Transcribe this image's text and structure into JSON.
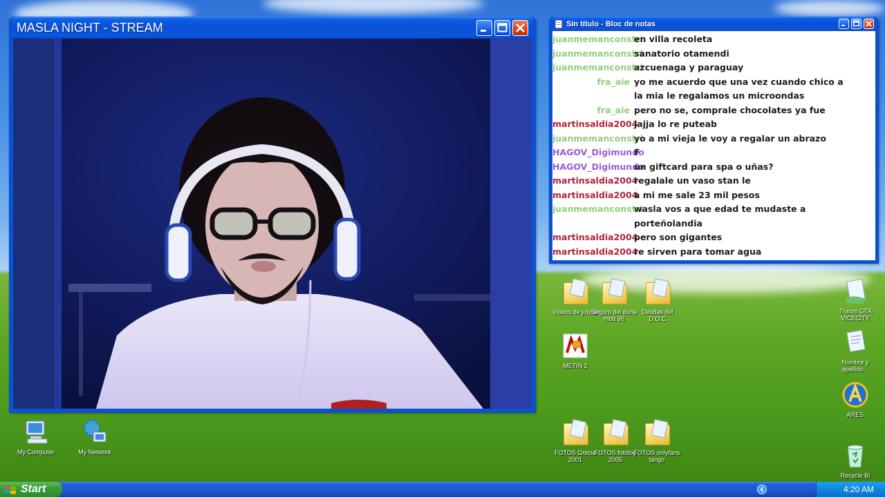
{
  "stream_window": {
    "title": "MASLA NIGHT - STREAM"
  },
  "notepad": {
    "title": "Sin título - Bloc de notas",
    "messages": [
      {
        "user": "juanmemanconstri",
        "text": "en villa recoleta",
        "color": "#8fd07a"
      },
      {
        "user": "juanmemanconstri",
        "text": "sanatorio otamendi",
        "color": "#8fd07a"
      },
      {
        "user": "juanmemanconstri",
        "text": "azcuenaga y paraguay",
        "color": "#8fd07a"
      },
      {
        "user": "fra_aie",
        "text": "yo me acuerdo que una vez cuando chico a la mia le regalamos un microondas",
        "color": "#8fd07a"
      },
      {
        "user": "fra_aie",
        "text": "pero no se, comprale chocolates ya fue",
        "color": "#8fd07a"
      },
      {
        "user": "martinsaldia2004",
        "text": "jajja lo re puteab",
        "color": "#b1223c"
      },
      {
        "user": "juanmemanconstri",
        "text": "yo a mi vieja le voy a regalar un abrazo",
        "color": "#8fd07a"
      },
      {
        "user": "HAGOV_Digimundo",
        "text": "F",
        "color": "#9b5bd6"
      },
      {
        "user": "HAGOV_Digimundo",
        "text": "un giftcard para spa o uñas?",
        "color": "#9b5bd6"
      },
      {
        "user": "martinsaldia2004",
        "text": "regalale un vaso stan le",
        "color": "#b1223c"
      },
      {
        "user": "martinsaldia2004",
        "text": "a mi me sale 23 mil pesos",
        "color": "#b1223c"
      },
      {
        "user": "juanmemanconstri",
        "text": "wasla vos a que edad te mudaste a porteñolandia",
        "color": "#8fd07a"
      },
      {
        "user": "martinsaldia2004",
        "text": "pero son gigantes",
        "color": "#b1223c"
      },
      {
        "user": "martinsaldia2004",
        "text": "re sirven para tomar agua",
        "color": "#b1223c"
      }
    ]
  },
  "desktop_icons": {
    "my_computer": "My Computer",
    "my_network": "My Network",
    "videos": "Videos de july3p",
    "seguro": "Seguro del duna mod 96",
    "deudas": "Deudas del D.O.C",
    "metin": "METIN 2",
    "fotos_grecia": "FOTOS Grecia 2001",
    "fotos_fotolog": "FOTOS fotolog 2005",
    "fotos_onlyfans": "FOTOS onlyfans tango",
    "trucos": "Trucos GTA VICECITY",
    "nombre": "Nombre y apellido...",
    "ares": "ARES",
    "recycle": "Recycle Bi"
  },
  "taskbar": {
    "start_label": "Start",
    "clock": "4:20 AM"
  },
  "icons": {
    "start": "windows-flag-icon",
    "tray": "chevron-left-icon"
  }
}
